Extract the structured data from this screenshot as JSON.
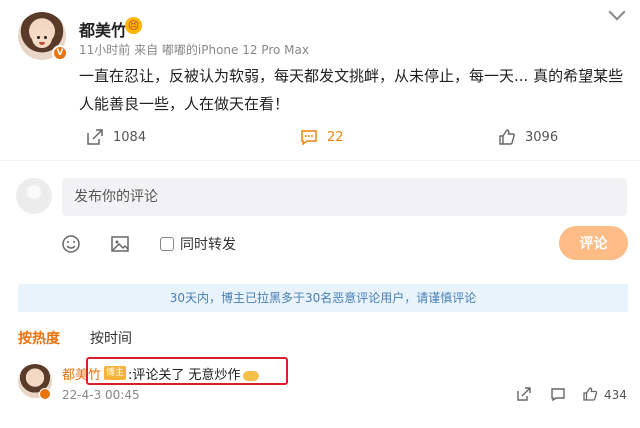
{
  "post": {
    "username": "都美竹",
    "mood_icon": "emoji-icon",
    "meta": "11小时前  来自 嘟嘟的iPhone 12 Pro Max",
    "content": "一直在忍让，反被认为软弱，每天都发文挑衅，从未停止，每一天... 真的希望某些人能善良一些，人在做天在看！",
    "share_count": "1084",
    "comment_count": "22",
    "like_count": "3096"
  },
  "comment_box": {
    "placeholder": "发布你的评论",
    "repost_label": "同时转发",
    "submit_label": "评论"
  },
  "notice": "30天内，博主已拉黑多于30名恶意评论用户，请谨慎评论",
  "sort_tabs": {
    "hot": "按热度",
    "time": "按时间"
  },
  "comment": {
    "username": "都美竹",
    "author_tag": "博主",
    "text": ":评论关了 无意炒作",
    "time": "22-4-3 00:45",
    "like_count": "434"
  },
  "colors": {
    "accent": "#e8720c",
    "submit_button": "#fdbb86",
    "notice_bg": "#e9f3fc",
    "notice_text": "#467fb4",
    "highlight_border": "#d8202a"
  }
}
